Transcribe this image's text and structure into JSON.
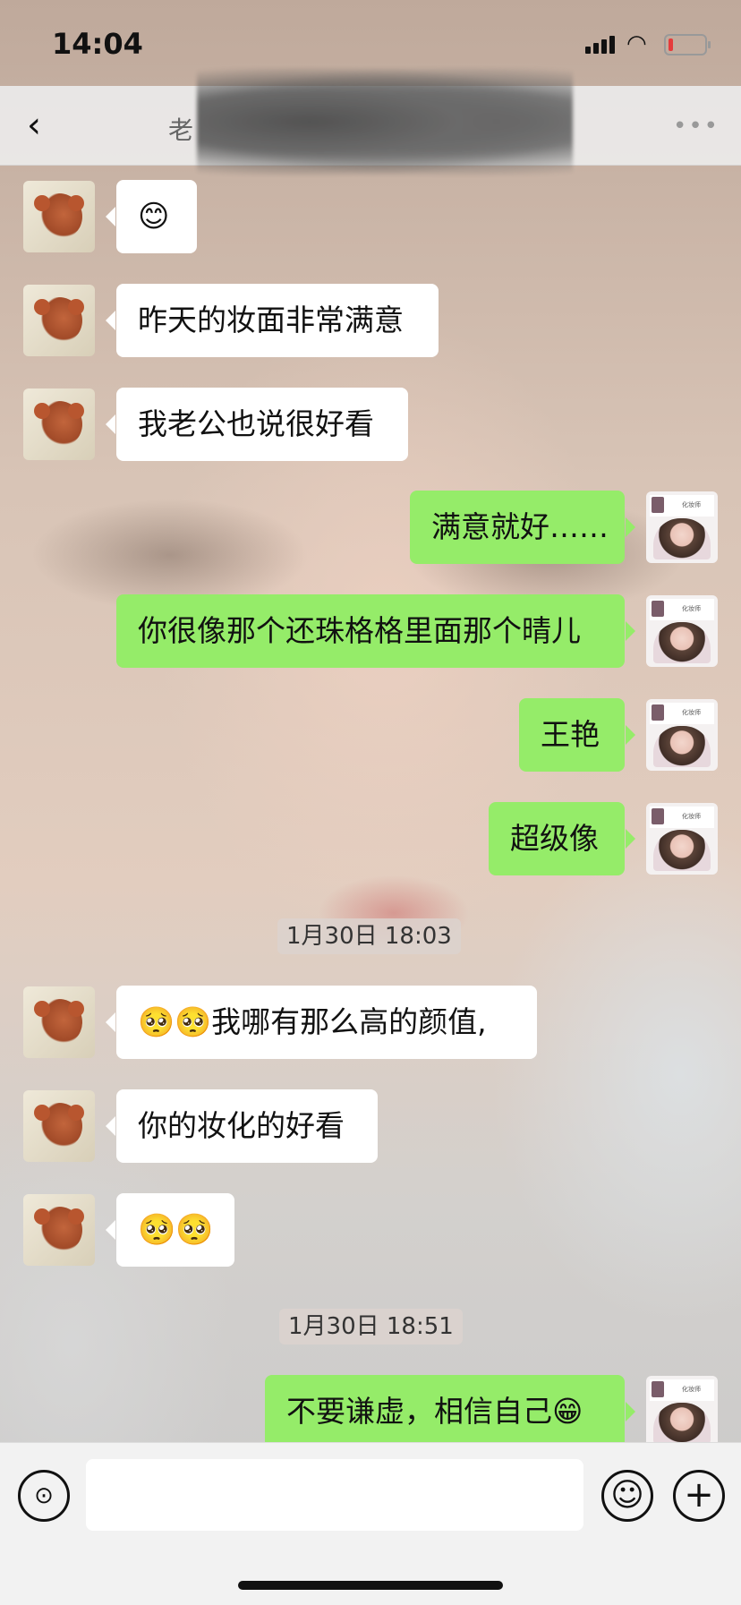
{
  "status": {
    "time": "14:04",
    "wifi_icon": "wifi-icon",
    "battery_icon": "battery-icon"
  },
  "header": {
    "title_visible": "老",
    "back_icon": "chevron-left-icon",
    "more_icon": "more-icon"
  },
  "messages": [
    {
      "side": "other",
      "text": "😊"
    },
    {
      "side": "other",
      "text": "昨天的妆面非常满意"
    },
    {
      "side": "other",
      "text": "我老公也说很好看"
    },
    {
      "side": "self",
      "text": "满意就好……"
    },
    {
      "side": "self",
      "text": "你很像那个还珠格格里面那个晴儿"
    },
    {
      "side": "self",
      "text": "王艳"
    },
    {
      "side": "self",
      "text": "超级像"
    },
    {
      "type": "timestamp",
      "text": "1月30日 18:03"
    },
    {
      "side": "other",
      "text": "🥺🥺我哪有那么高的颜值,"
    },
    {
      "side": "other",
      "text": "你的妆化的好看"
    },
    {
      "side": "other",
      "text": "🥺🥺"
    },
    {
      "type": "timestamp",
      "text": "1月30日 18:51"
    },
    {
      "side": "self",
      "text": "不要谦虚，相信自己😁"
    }
  ],
  "input": {
    "value": "",
    "placeholder": ""
  },
  "colors": {
    "self_bubble": "#95ec69",
    "other_bubble": "#ffffff"
  }
}
